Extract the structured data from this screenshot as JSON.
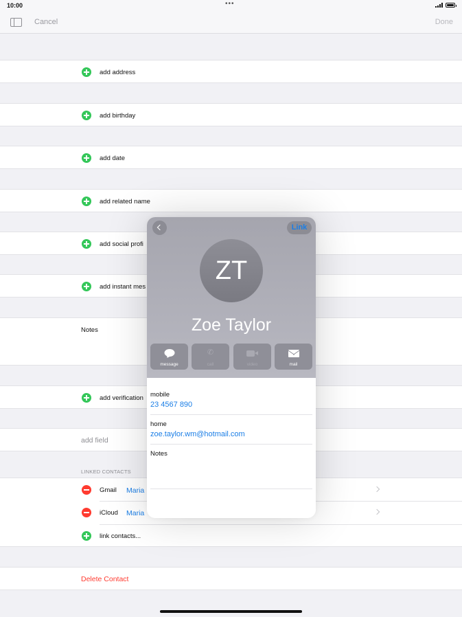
{
  "status": {
    "time": "10:00",
    "dots": "•••"
  },
  "nav": {
    "cancel": "Cancel",
    "done": "Done"
  },
  "rows": {
    "add_address": "add address",
    "add_birthday": "add birthday",
    "add_date": "add date",
    "add_related_name": "add related name",
    "add_social_profile": "add social profi",
    "add_instant_message": "add instant mes",
    "notes": "Notes",
    "add_verification": "add verification",
    "add_field": "add field"
  },
  "linked": {
    "header": "LINKED CONTACTS",
    "items": [
      {
        "source": "Gmail",
        "name": "Maria"
      },
      {
        "source": "iCloud",
        "name": "Maria"
      }
    ],
    "link_contacts": "link contacts..."
  },
  "delete": "Delete Contact",
  "popover": {
    "link": "Link",
    "initials": "ZT",
    "name": "Zoe Taylor",
    "actions": [
      "message",
      "call",
      "video",
      "mail"
    ],
    "fields": [
      {
        "label": "mobile",
        "value": "23 4567 890"
      },
      {
        "label": "home",
        "value": "zoe.taylor.wm@hotmail.com"
      }
    ],
    "notes_label": "Notes"
  },
  "colors": {
    "accent": "#1a7ee6",
    "add": "#34c759",
    "remove": "#ff3b30",
    "destructive": "#ff3b30"
  }
}
